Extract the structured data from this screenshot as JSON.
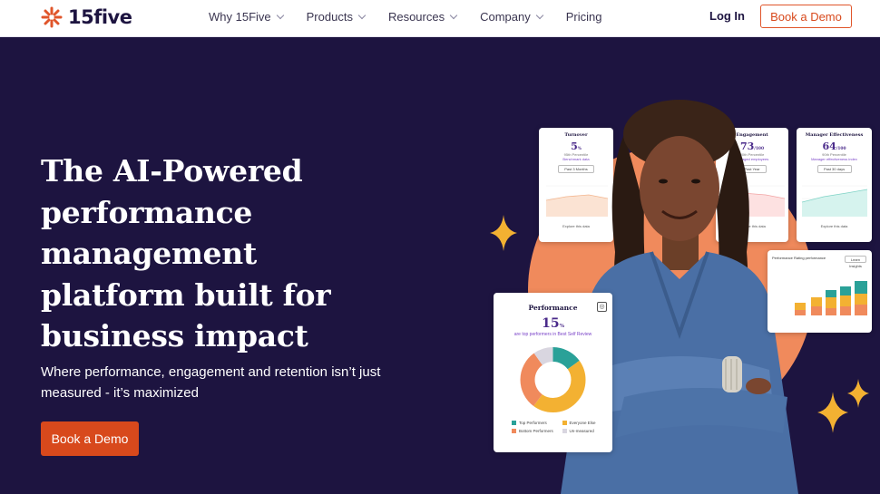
{
  "brand": {
    "name": "15five",
    "accent": "#d8491c",
    "bg": "#1d1440"
  },
  "nav": {
    "items": [
      {
        "label": "Why 15Five",
        "dropdown": true
      },
      {
        "label": "Products",
        "dropdown": true
      },
      {
        "label": "Resources",
        "dropdown": true
      },
      {
        "label": "Company",
        "dropdown": true
      },
      {
        "label": "Pricing",
        "dropdown": false
      }
    ],
    "login": "Log In",
    "demo": "Book a Demo"
  },
  "hero": {
    "headline": "The AI-Powered performance management platform built for business impact",
    "subtext": "Where performance, engagement and retention isn’t just measured - it’s maximized",
    "cta": "Book a Demo"
  },
  "cards": {
    "turnover": {
      "title": "Turnover",
      "value": "5",
      "unit": "%",
      "percentile": "95th Percentile",
      "note": "Benchmark data",
      "button": "Past 3 Months",
      "link": "Explore this data"
    },
    "engagement": {
      "title": "Engagement",
      "value": "73",
      "unit": "/100",
      "percentile": "90th Percentile",
      "note": "Engaged employees",
      "button": "Past Year",
      "link": "Explore this data"
    },
    "manager": {
      "title": "Manager Effectiveness",
      "value": "64",
      "unit": "/100",
      "percentile": "90th Percentile",
      "note": "Manager effectiveness index",
      "button": "Past 30 days",
      "link": "Explore this data"
    },
    "performance": {
      "title": "Performance",
      "value": "15",
      "unit": "%",
      "caption": "are top performers in Best Self Review",
      "legend": [
        {
          "label": "Top Performers",
          "color": "#2aa198"
        },
        {
          "label": "Everyone Else",
          "color": "#f3b132"
        },
        {
          "label": "Bottom Performers",
          "color": "#f08a5c"
        },
        {
          "label": "Un-measured",
          "color": "#d9d6e0"
        }
      ],
      "donut": [
        15,
        45,
        30,
        10
      ]
    },
    "rating": {
      "title": "Performance Rating performance",
      "button": "Learn Insights"
    }
  }
}
